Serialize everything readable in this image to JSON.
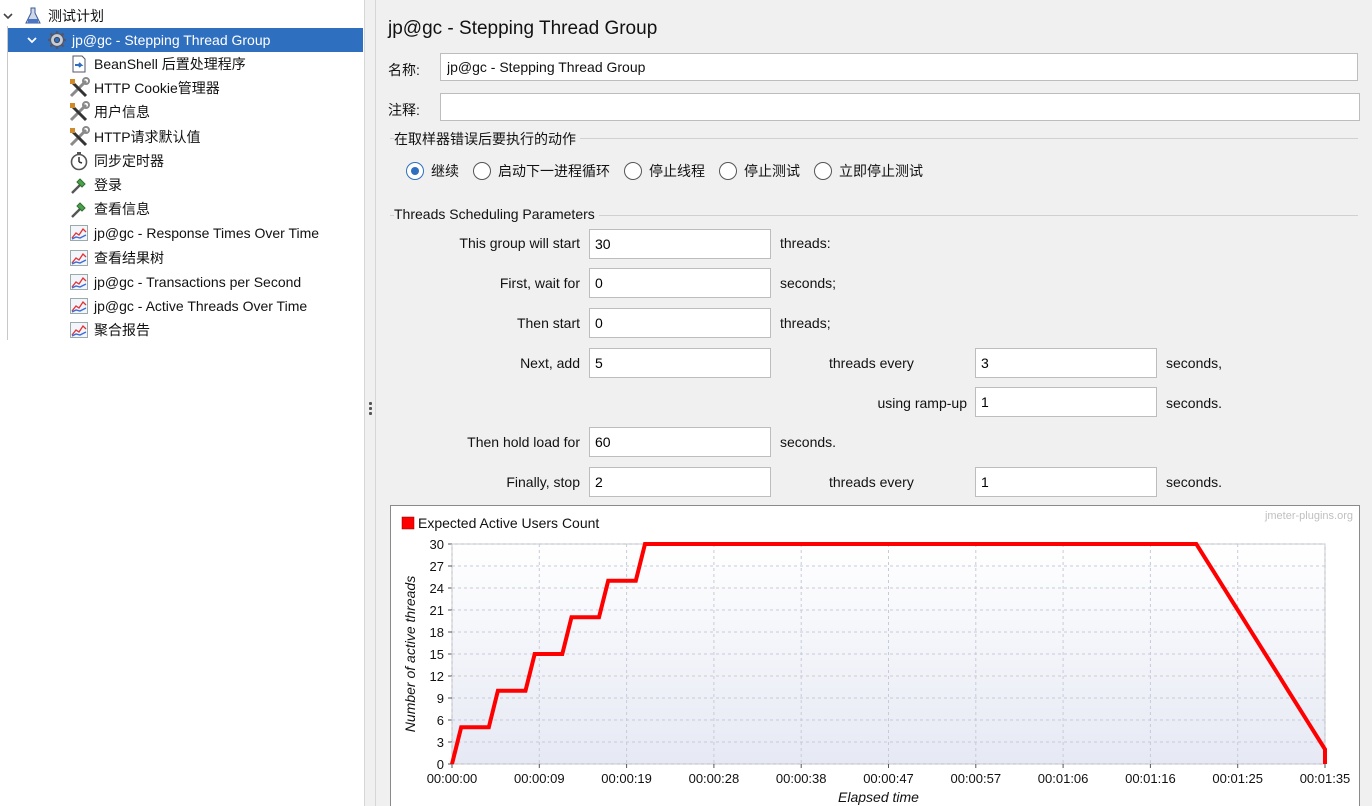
{
  "tree": {
    "root": {
      "label": "测试计划",
      "icon": "test-plan-icon"
    },
    "selected": {
      "label": "jp@gc - Stepping Thread Group",
      "icon": "gear-icon"
    },
    "children": [
      {
        "label": "BeanShell 后置处理程序",
        "icon": "script-icon"
      },
      {
        "label": "HTTP Cookie管理器",
        "icon": "wrench-icon"
      },
      {
        "label": "用户信息",
        "icon": "wrench-icon"
      },
      {
        "label": "HTTP请求默认值",
        "icon": "wrench-icon"
      },
      {
        "label": "同步定时器",
        "icon": "timer-icon"
      },
      {
        "label": "登录",
        "icon": "sampler-icon"
      },
      {
        "label": "查看信息",
        "icon": "sampler-icon"
      },
      {
        "label": "jp@gc - Response Times Over Time",
        "icon": "graph-icon"
      },
      {
        "label": "查看结果树",
        "icon": "graph-icon"
      },
      {
        "label": "jp@gc - Transactions per Second",
        "icon": "graph-icon"
      },
      {
        "label": "jp@gc - Active Threads Over Time",
        "icon": "graph-icon"
      },
      {
        "label": "聚合报告",
        "icon": "graph-icon"
      }
    ]
  },
  "panel": {
    "title": "jp@gc - Stepping Thread Group",
    "name_label": "名称:",
    "name_value": "jp@gc - Stepping Thread Group",
    "comment_label": "注释:",
    "comment_value": "",
    "error_group_title": "在取样器错误后要执行的动作",
    "error_actions": [
      "继续",
      "启动下一进程循环",
      "停止线程",
      "停止测试",
      "立即停止测试"
    ],
    "error_action_selected": 0,
    "sched_group_title": "Threads Scheduling Parameters",
    "sched": {
      "start_label": "This group will start",
      "start_value": "30",
      "start_unit": "threads:",
      "wait_label": "First, wait for",
      "wait_value": "0",
      "wait_unit": "seconds;",
      "then_start_label": "Then start",
      "then_start_value": "0",
      "then_start_unit": "threads;",
      "next_add_label": "Next, add",
      "next_add_value": "5",
      "next_add_mid": "threads every",
      "next_add_every": "3",
      "next_add_unit": "seconds,",
      "rampup_label": "using ramp-up",
      "rampup_value": "1",
      "rampup_unit": "seconds.",
      "hold_label": "Then hold load for",
      "hold_value": "60",
      "hold_unit": "seconds.",
      "stop_label": "Finally, stop",
      "stop_value": "2",
      "stop_mid": "threads every",
      "stop_every": "1",
      "stop_unit": "seconds."
    }
  },
  "chart_data": {
    "type": "line",
    "legend": "Expected Active Users Count",
    "watermark": "jmeter-plugins.org",
    "xlabel": "Elapsed time",
    "ylabel": "Number of active threads",
    "ylim": [
      0,
      30
    ],
    "xlim_seconds": [
      0,
      95
    ],
    "yticks": [
      "0",
      "3",
      "6",
      "9",
      "12",
      "15",
      "18",
      "21",
      "24",
      "27",
      "30"
    ],
    "xticks": [
      "00:00:00",
      "00:00:09",
      "00:00:19",
      "00:00:28",
      "00:00:38",
      "00:00:47",
      "00:00:57",
      "00:01:06",
      "00:01:16",
      "00:01:25",
      "00:01:35"
    ],
    "series_color": "#ff0000",
    "points": [
      [
        0,
        0
      ],
      [
        1,
        5
      ],
      [
        4,
        5
      ],
      [
        5,
        10
      ],
      [
        8,
        10
      ],
      [
        9,
        15
      ],
      [
        12,
        15
      ],
      [
        13,
        20
      ],
      [
        16,
        20
      ],
      [
        17,
        25
      ],
      [
        20,
        25
      ],
      [
        21,
        30
      ],
      [
        81,
        30
      ],
      [
        82,
        28
      ],
      [
        83,
        26
      ],
      [
        84,
        24
      ],
      [
        85,
        22
      ],
      [
        86,
        20
      ],
      [
        87,
        18
      ],
      [
        88,
        16
      ],
      [
        89,
        14
      ],
      [
        90,
        12
      ],
      [
        91,
        10
      ],
      [
        92,
        8
      ],
      [
        93,
        6
      ],
      [
        94,
        4
      ],
      [
        95,
        2
      ],
      [
        95,
        0
      ]
    ]
  }
}
